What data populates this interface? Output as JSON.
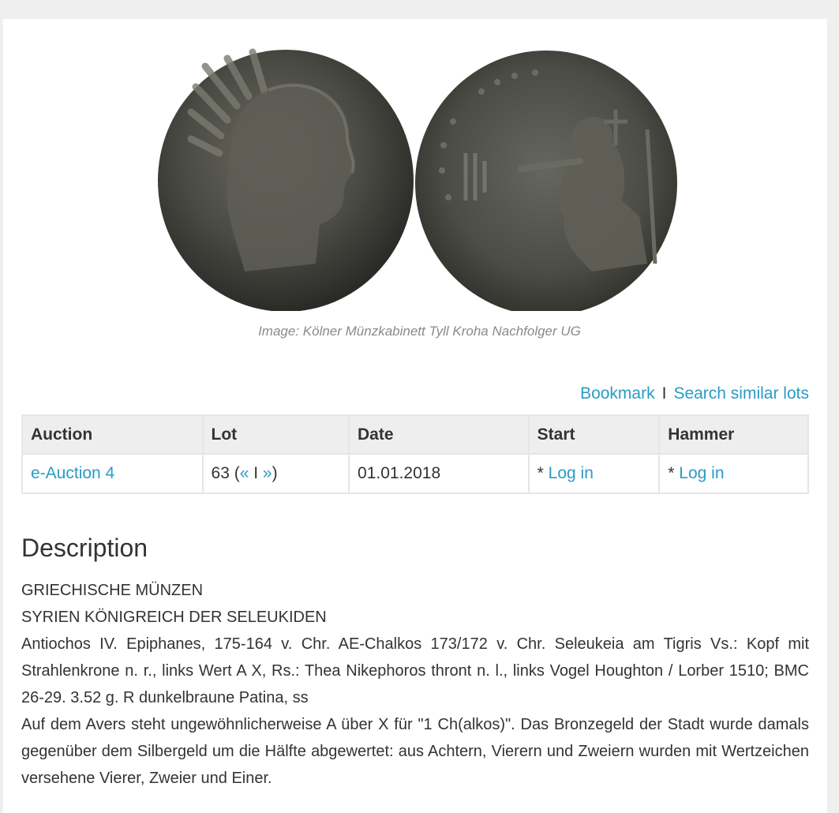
{
  "image": {
    "caption": "Image: Kölner Münzkabinett Tyll Kroha Nachfolger UG",
    "obverse_label": "coin-obverse",
    "reverse_label": "coin-reverse"
  },
  "actions": {
    "bookmark": "Bookmark",
    "separator": "I",
    "search_similar": "Search similar lots"
  },
  "table": {
    "headers": [
      "Auction",
      "Lot",
      "Date",
      "Start",
      "Hammer"
    ],
    "row": {
      "auction": "e-Auction 4",
      "lot_number": "63 (",
      "lot_prev": "«",
      "lot_sep": " I ",
      "lot_next": "»",
      "lot_close": ")",
      "date": "01.01.2018",
      "start_prefix": "* ",
      "start_link": "Log in",
      "hammer_prefix": "* ",
      "hammer_link": "Log in"
    }
  },
  "description": {
    "heading": "Description",
    "lines": [
      "GRIECHISCHE MÜNZEN",
      "SYRIEN KÖNIGREICH DER SELEUKIDEN",
      "Antiochos IV. Epiphanes, 175-164 v. Chr. AE-Chalkos 173/172 v. Chr. Seleukeia am Tigris Vs.: Kopf mit Strahlenkrone n. r., links Wert A X, Rs.: Thea Nikephoros thront n. l., links Vogel Houghton / Lorber 1510; BMC 26-29. 3.52 g. R dunkelbraune Patina, ss",
      "Auf dem Avers steht ungewöhnlicherweise A über X für \"1 Ch(alkos)\". Das Bronzegeld der Stadt wurde damals gegenüber dem Silbergeld um die Hälfte abgewertet: aus Achtern, Vierern und Zweiern wurden mit Wertzeichen versehene Vierer, Zweier und Einer."
    ]
  },
  "colors": {
    "link": "#2a9bc6",
    "text": "#333333",
    "header_bg": "#eeeeee",
    "page_bg": "#efefef"
  }
}
